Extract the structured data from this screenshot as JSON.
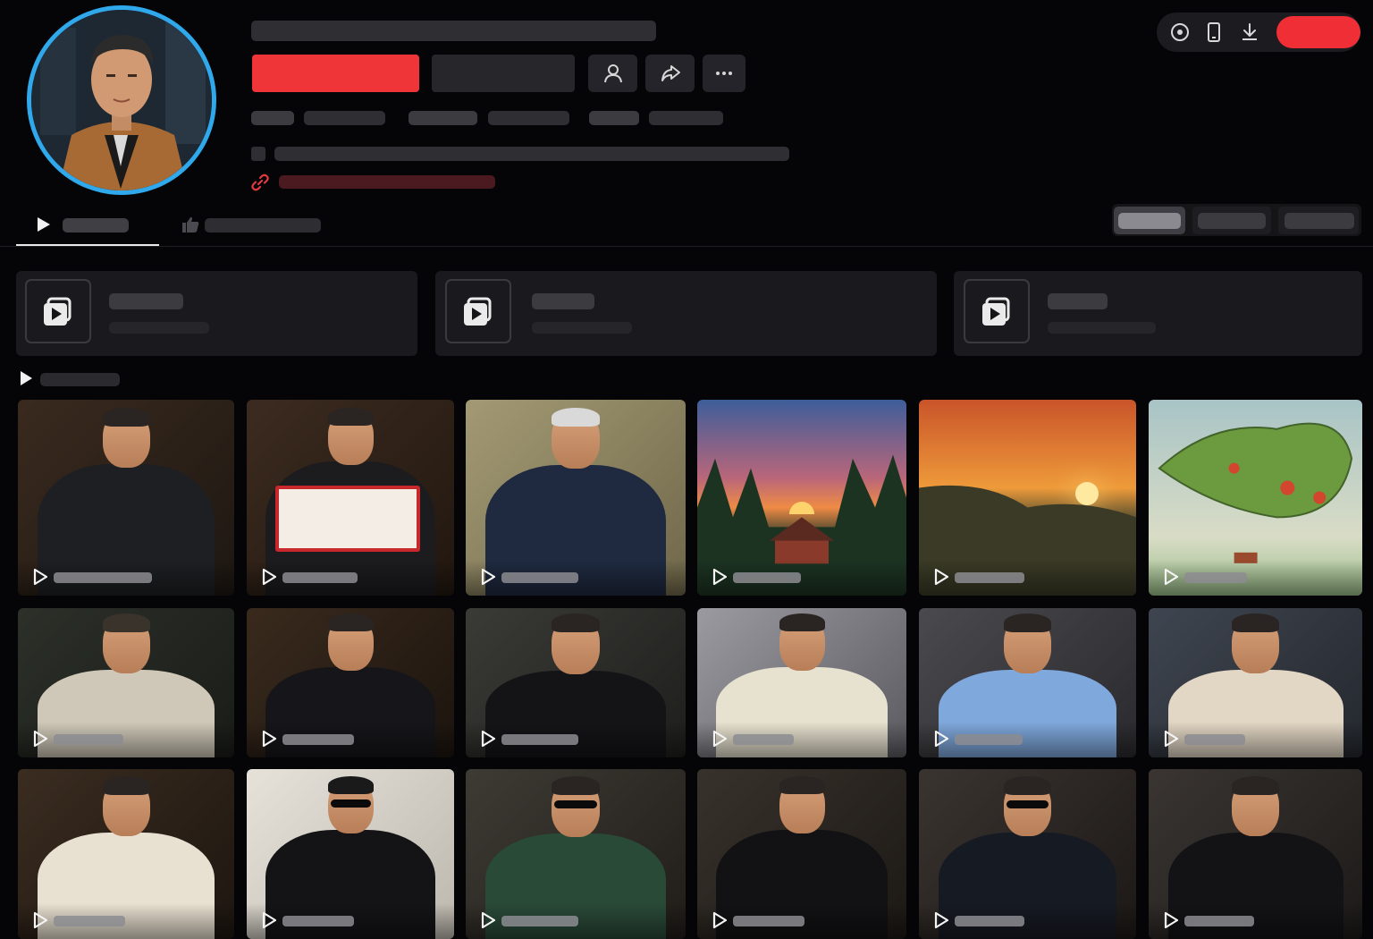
{
  "profile": {
    "avatar_icon": "user-avatar-portrait",
    "avatar_ring_color": "#2fa8ec",
    "name": "",
    "follow_label": "",
    "message_label": "",
    "bio": "",
    "link": ""
  },
  "top_bar": {
    "icons": [
      "live-icon",
      "device-icon",
      "download-icon"
    ],
    "login_label": "",
    "accent": "#ef2e36"
  },
  "tabs": [
    {
      "label": "",
      "icon": "play-icon",
      "active": true
    },
    {
      "label": "",
      "icon": "thumbs-up-icon",
      "active": false
    }
  ],
  "sort_buttons": [
    "",
    "",
    ""
  ],
  "collections": [
    {
      "title": "",
      "subtitle": "",
      "icon": "playlist-icon"
    },
    {
      "title": "",
      "subtitle": "",
      "icon": "playlist-icon"
    },
    {
      "title": "",
      "subtitle": "",
      "icon": "playlist-icon"
    }
  ],
  "section_title": "",
  "videos": [
    {
      "scene": "man-in-armchair",
      "views": ""
    },
    {
      "scene": "man-holding-sign",
      "views": ""
    },
    {
      "scene": "older-man-portrait",
      "views": ""
    },
    {
      "scene": "forest-sunset-house",
      "views": ""
    },
    {
      "scene": "field-sunset",
      "views": ""
    },
    {
      "scene": "map-landscape",
      "views": ""
    },
    {
      "scene": "man-facepalm",
      "views": ""
    },
    {
      "scene": "man-thumbs-up",
      "views": ""
    },
    {
      "scene": "man-portrait-dark",
      "views": ""
    },
    {
      "scene": "man-hoodie-couch",
      "views": ""
    },
    {
      "scene": "man-blue-shirt",
      "views": ""
    },
    {
      "scene": "man-standing-room",
      "views": ""
    },
    {
      "scene": "man-white-tee",
      "views": ""
    },
    {
      "scene": "man-sunglasses-hoodie",
      "views": ""
    },
    {
      "scene": "man-leather-chair",
      "views": ""
    },
    {
      "scene": "man-black-sweater",
      "views": ""
    },
    {
      "scene": "man-sunglasses-sweater",
      "views": ""
    },
    {
      "scene": "man-dark-jacket",
      "views": ""
    }
  ]
}
